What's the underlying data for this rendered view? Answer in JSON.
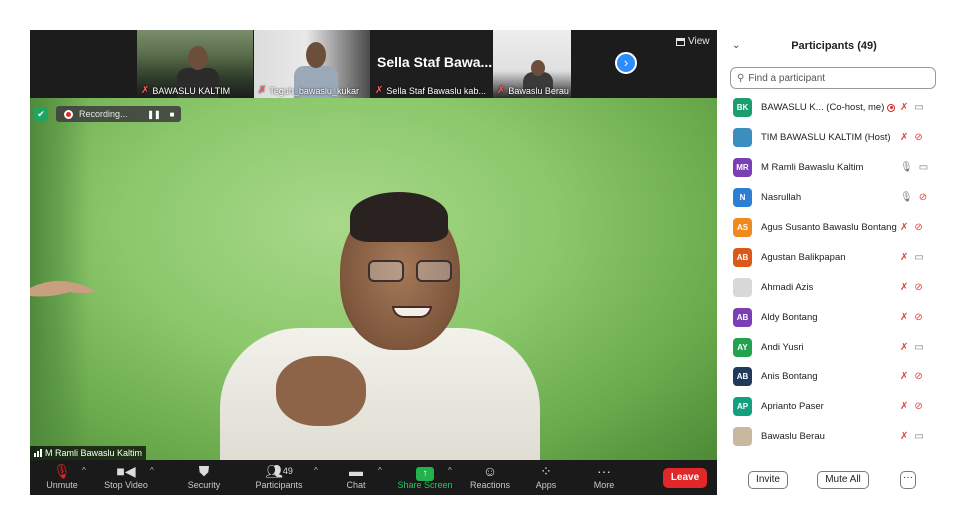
{
  "meeting": {
    "thumbnails": [
      {
        "label": "BAWASLU KALTIM"
      },
      {
        "label": "Teguh_bawaslu_kukar"
      },
      {
        "big_name": "Sella Staf Bawa...",
        "label": "Sella Staf Bawaslu kab..."
      },
      {
        "label": "Bawaslu Berau"
      }
    ],
    "view_label": "View",
    "recording_text": "Recording...",
    "pause_glyph": "❚❚",
    "stop_glyph": "■",
    "speaker_name": "M Ramli Bawaslu Kaltim"
  },
  "toolbar": {
    "unmute": "Unmute",
    "stop_video": "Stop Video",
    "security": "Security",
    "participants": "Participants",
    "participants_count": "49",
    "chat": "Chat",
    "share_screen": "Share Screen",
    "reactions": "Reactions",
    "apps": "Apps",
    "more": "More",
    "leave": "Leave"
  },
  "panel": {
    "title": "Participants (49)",
    "search_placeholder": "Find a participant",
    "participants": [
      {
        "initials": "BK",
        "color": "#1a9e6e",
        "name": "BAWASLU K...  (Co-host, me)",
        "mic": "muted",
        "cam": "on",
        "recording": true
      },
      {
        "initials": "",
        "color": "#3a8fbf",
        "name": "TIM BAWASLU KALTIM (Host)",
        "mic": "muted",
        "cam": "off",
        "avatar_icon": "logo-avatar-icon"
      },
      {
        "initials": "MR",
        "color": "#7b3fb5",
        "name": "M Ramli Bawaslu Kaltim",
        "mic": "on",
        "cam": "on"
      },
      {
        "initials": "N",
        "color": "#2d7fd6",
        "name": "Nasrullah",
        "mic": "on",
        "cam": "off"
      },
      {
        "initials": "AS",
        "color": "#f08a1e",
        "name": "Agus Susanto Bawaslu Bontang",
        "mic": "muted",
        "cam": "off"
      },
      {
        "initials": "AB",
        "color": "#d9581a",
        "name": "Agustan Balikpapan",
        "mic": "muted",
        "cam": "on"
      },
      {
        "initials": "",
        "color": "#d8d8d8",
        "name": "Ahmadi Azis",
        "mic": "muted",
        "cam": "off",
        "avatar_icon": "photo-avatar-icon"
      },
      {
        "initials": "AB",
        "color": "#7b3fb5",
        "name": "Aldy Bontang",
        "mic": "muted",
        "cam": "off"
      },
      {
        "initials": "AY",
        "color": "#22a24e",
        "name": "Andi Yusri",
        "mic": "muted",
        "cam": "on"
      },
      {
        "initials": "AB",
        "color": "#1f3a5a",
        "name": "Anis Bontang",
        "mic": "muted",
        "cam": "off"
      },
      {
        "initials": "AP",
        "color": "#12a07e",
        "name": "Aprianto Paser",
        "mic": "muted",
        "cam": "off"
      },
      {
        "initials": "",
        "color": "#c9b8a0",
        "name": "Bawaslu Berau",
        "mic": "muted",
        "cam": "on",
        "avatar_icon": "photo-avatar-icon"
      }
    ],
    "invite": "Invite",
    "mute_all": "Mute All",
    "more": "···"
  }
}
